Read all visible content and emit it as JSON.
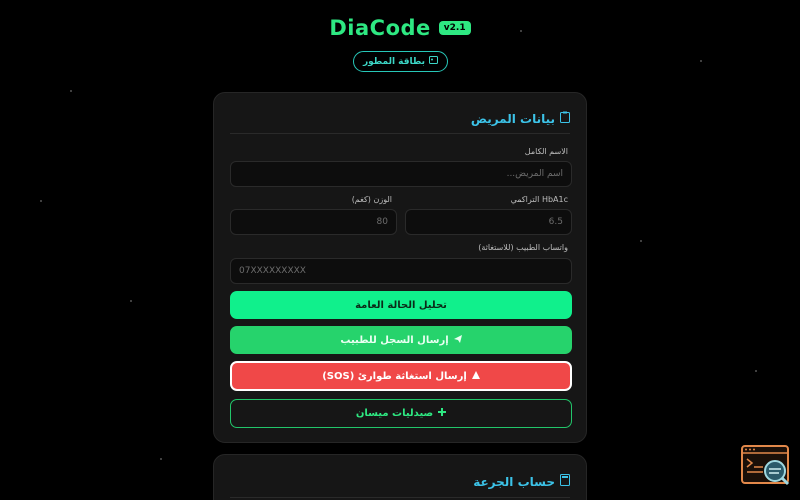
{
  "header": {
    "app_title": "DiaCode",
    "version": "v2.1",
    "dev_card_label": "بطاقة المطور",
    "dev_card_icon": "id-card-icon"
  },
  "patient_card": {
    "title": "بيانات المريض",
    "title_icon": "clipboard-icon",
    "full_name_label": "الاسم الكامل",
    "full_name_placeholder": "اسم المريض...",
    "weight_label": "الوزن (كغم)",
    "weight_placeholder": "80",
    "hba1c_label": "HbA1c التراكمي",
    "hba1c_placeholder": "6.5",
    "whatsapp_label": "واتساب الطبيب (للاستغاثة)",
    "whatsapp_placeholder": "07XXXXXXXXX",
    "analyze_button": "تحليل الحالة العامة",
    "send_button": "إرسال السجل للطبيب",
    "send_icon": "send-icon",
    "sos_button": "إرسال استغاثة طوارئ (SOS)",
    "sos_icon": "alert-icon",
    "pharmacies_button": "صيدليات ميسان",
    "pharmacies_icon": "pharmacy-icon"
  },
  "dose_card": {
    "title": "حساب الجرعة",
    "title_icon": "calculator-icon"
  },
  "colors": {
    "accent_green": "#2ee882",
    "accent_cyan": "#3cc3e8",
    "danger_red": "#f04848"
  }
}
